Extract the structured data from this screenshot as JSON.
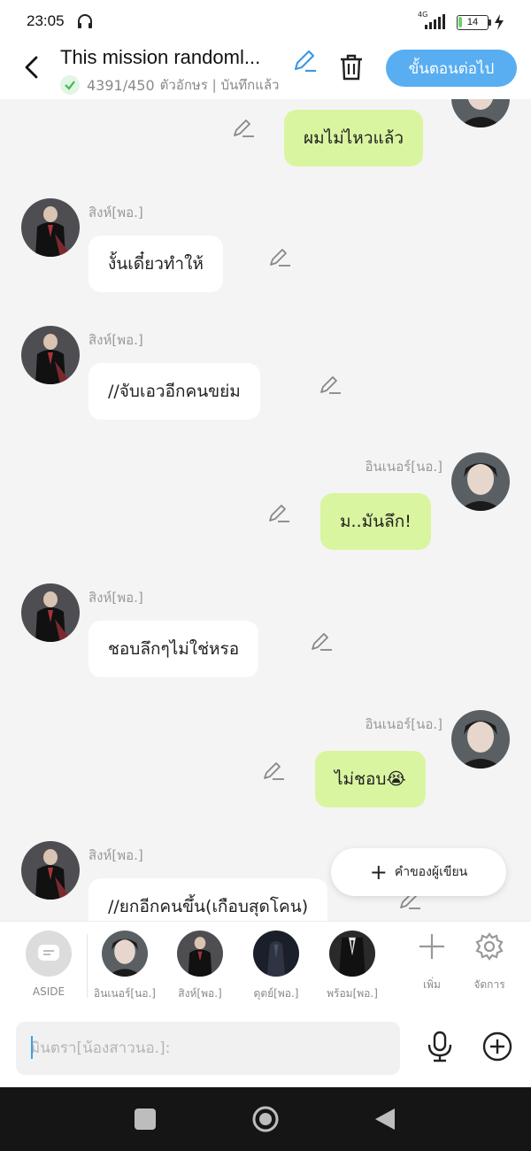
{
  "status": {
    "time": "23:05",
    "network": "4G",
    "battery": "14",
    "battery_level": 0.14
  },
  "header": {
    "title": "This mission randoml...",
    "word_count": "4391/450",
    "status_text": "ตัวอักษร | บันทึกแล้ว",
    "next_label": "ขั้นตอนต่อไป"
  },
  "messages": [
    {
      "side": "right",
      "speaker": "",
      "text": "ผมไม่ไหวแล้ว"
    },
    {
      "side": "left",
      "speaker": "สิงห์[พอ.]",
      "text": "งั้นเดี๋ยวทำให้"
    },
    {
      "side": "left",
      "speaker": "สิงห์[พอ.]",
      "text": "//จับเอวอีกคนขย่ม"
    },
    {
      "side": "right",
      "speaker": "อินเนอร์[นอ.]",
      "text": "ม..มันลึก!"
    },
    {
      "side": "left",
      "speaker": "สิงห์[พอ.]",
      "text": "ชอบลึกๆไม่ใช่หรอ"
    },
    {
      "side": "right",
      "speaker": "อินเนอร์[นอ.]",
      "text": "ไม่ชอบ😭"
    },
    {
      "side": "left",
      "speaker": "สิงห์[พอ.]",
      "text": "//ยกอีกคนขึ้น(เกือบสุดโคน)"
    }
  ],
  "author_note_label": "คำของผู้เขียน",
  "characters": [
    {
      "label": "ASIDE"
    },
    {
      "label": "อินเนอร์[นอ.]"
    },
    {
      "label": "สิงห์[พอ.]"
    },
    {
      "label": "ดุตย์[พอ.]"
    },
    {
      "label": "พร้อม[พอ.]"
    }
  ],
  "tools": {
    "add_label": "เพิ่ม",
    "manage_label": "จัดการ"
  },
  "input": {
    "placeholder": "มินตรา[น้องสาวนอ.]:"
  },
  "colors": {
    "accent": "#58aef0",
    "right_bubble": "#daf5a0",
    "left_bubble": "#ffffff",
    "check": "#3dbb4f"
  },
  "icons": [
    "back-arrow-icon",
    "pencil-icon",
    "trash-icon",
    "check-icon",
    "plus-icon",
    "mic-icon",
    "gear-icon",
    "aside-icon",
    "headphones-icon",
    "signal-icon",
    "bolt-icon"
  ]
}
